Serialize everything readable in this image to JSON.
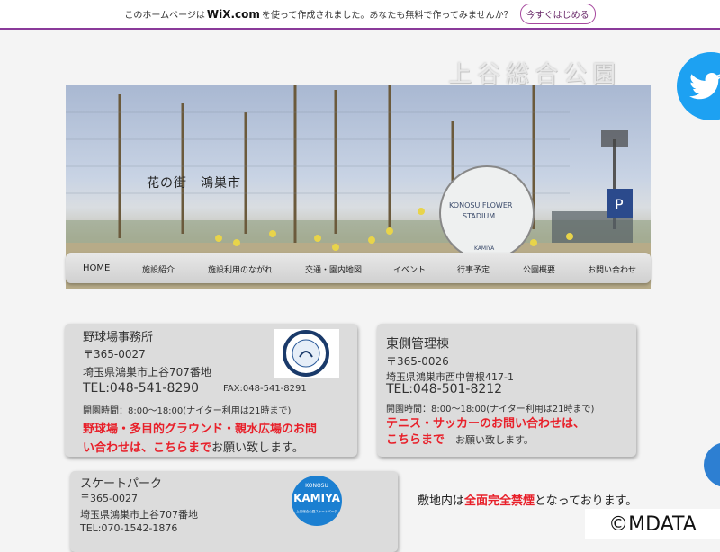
{
  "wix_bar": {
    "text_before": "このホームページは",
    "logo": "WiX.com",
    "text_after": "を使って作成されました。あなたも無料で作ってみませんか？",
    "start_label": "今すぐはじめる"
  },
  "site_title": "上谷総合公園",
  "hero": {
    "caption": "花の街　鴻巣市",
    "stadium_sign_line1": "KONOSU FLOWER",
    "stadium_sign_line2": "STADIUM",
    "stadium_sign_line3": "KAMIYA",
    "parking_sign": "P"
  },
  "nav": {
    "items": [
      "HOME",
      "施設紹介",
      "施設利用のながれ",
      "交通・園内地図",
      "イベント",
      "行事予定",
      "公園概要",
      "お問い合わせ"
    ]
  },
  "stadium_card": {
    "title": "野球場事務所",
    "postal": "〒365-0027",
    "address": "埼玉県鴻巣市上谷707番地",
    "tel": "TEL:048-541-8290",
    "fax": "FAX:048-541-8291",
    "hours": "開園時間：8:00～18:00(ナイター利用は21時まで)",
    "inquiry_red_1": "野球場・多目的グラウンド・親水広場のお問",
    "inquiry_red_2": "い合わせは、こちらまで",
    "inquiry_tail": "お願い致します。",
    "logo_text": "KONOSU FLOWER STADIUM"
  },
  "east_card": {
    "title": "東側管理棟",
    "postal": "〒365-0026",
    "address": "埼玉県鴻巣市西中曽根417-1",
    "tel": "TEL:048-501-8212",
    "hours": "開園時間：8:00～18:00(ナイター利用は21時まで)",
    "inquiry_red_1": "テニス・サッカーのお問い合わせは、",
    "inquiry_red_2": "こちらまで",
    "inquiry_tail": "お願い致します。"
  },
  "skate_card": {
    "title": "スケートパーク",
    "postal": "〒365-0027",
    "address": "埼玉県鴻巣市上谷707番地",
    "tel": "TEL:070-1542-1876",
    "logo_top": "KONOSU",
    "logo_main": "KAMIYA",
    "logo_bottom": "上谷総合公園スケートパーク"
  },
  "notice": {
    "prefix": "敷地内は",
    "red": "全面完全禁煙",
    "suffix": "となっております。"
  },
  "copyright": "©MDATA",
  "colors": {
    "red_text": "#e8202a",
    "wix_purple": "#8a3a9a",
    "twitter_blue": "#1da1f2",
    "card_bg": "#dcdcdc"
  }
}
